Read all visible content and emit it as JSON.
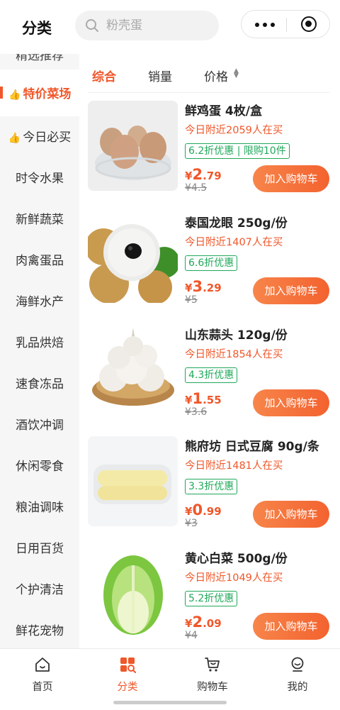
{
  "header": {
    "title": "分类",
    "search_placeholder": "粉壳蛋"
  },
  "sidebar": {
    "partial_top": "精选推荐",
    "active": {
      "label": "特价菜场",
      "icon": "thumbs-up-icon"
    },
    "items": [
      {
        "label": "今日必买",
        "icon": "thumbs-up-icon"
      },
      {
        "label": "时令水果"
      },
      {
        "label": "新鲜蔬菜"
      },
      {
        "label": "肉禽蛋品"
      },
      {
        "label": "海鲜水产"
      },
      {
        "label": "乳品烘焙"
      },
      {
        "label": "速食冻品"
      },
      {
        "label": "酒饮冲调"
      },
      {
        "label": "休闲零食"
      },
      {
        "label": "粮油调味"
      },
      {
        "label": "日用百货"
      },
      {
        "label": "个护清洁"
      },
      {
        "label": "鲜花宠物"
      }
    ]
  },
  "sort": {
    "tabs": [
      "综合",
      "销量",
      "价格"
    ],
    "active_index": 0
  },
  "products": [
    {
      "name": "鲜鸡蛋 4枚/盒",
      "sold": "今日附近2059人在买",
      "tag": "6.2折优惠 | 限购10件",
      "currency": "¥",
      "price_int": "2",
      "price_dec": ".79",
      "orig": "¥4.5",
      "button": "加入购物车",
      "image": "eggs"
    },
    {
      "name": "泰国龙眼 250g/份",
      "sold": "今日附近1407人在买",
      "tag": "6.6折优惠",
      "currency": "¥",
      "price_int": "3",
      "price_dec": ".29",
      "orig": "¥5",
      "button": "加入购物车",
      "image": "longan"
    },
    {
      "name": "山东蒜头 120g/份",
      "sold": "今日附近1854人在买",
      "tag": "4.3折优惠",
      "currency": "¥",
      "price_int": "1",
      "price_dec": ".55",
      "orig": "¥3.6",
      "button": "加入购物车",
      "image": "garlic"
    },
    {
      "name": "熊府坊 日式豆腐 90g/条",
      "sold": "今日附近1481人在买",
      "tag": "3.3折优惠",
      "currency": "¥",
      "price_int": "0",
      "price_dec": ".99",
      "orig": "¥3",
      "button": "加入购物车",
      "image": "tofu"
    },
    {
      "name": "黄心白菜 500g/份",
      "sold": "今日附近1049人在买",
      "tag": "5.2折优惠",
      "currency": "¥",
      "price_int": "2",
      "price_dec": ".09",
      "orig": "¥4",
      "button": "加入购物车",
      "image": "cabbage"
    }
  ],
  "tabbar": {
    "items": [
      {
        "label": "首页",
        "icon": "home-icon"
      },
      {
        "label": "分类",
        "icon": "category-icon"
      },
      {
        "label": "购物车",
        "icon": "cart-icon"
      },
      {
        "label": "我的",
        "icon": "profile-icon"
      }
    ],
    "active_index": 1
  },
  "colors": {
    "accent": "#f0572a",
    "tag_green": "#20a85a",
    "sidebar_bg": "#f6f6f6"
  }
}
